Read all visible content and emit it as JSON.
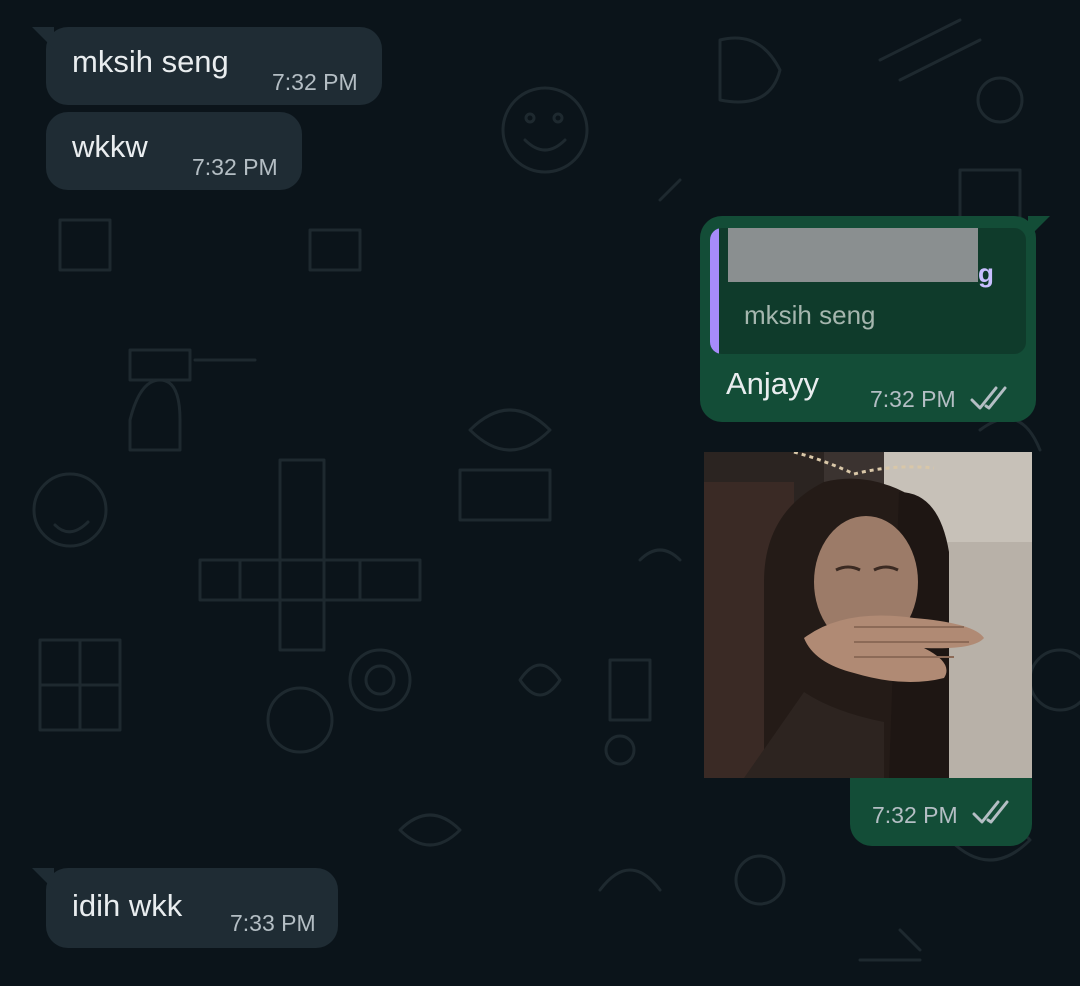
{
  "messages": [
    {
      "direction": "incoming",
      "text": "mksih seng",
      "time": "7:32 PM"
    },
    {
      "direction": "incoming",
      "text": "wkkw",
      "time": "7:32 PM"
    },
    {
      "direction": "outgoing",
      "quoted_text": "mksih seng",
      "text": "Anjayy",
      "time": "7:32 PM",
      "status": "read"
    },
    {
      "direction": "outgoing",
      "type": "image",
      "image_subject": "photo-of-person-covering-mouth",
      "time": "7:32 PM",
      "status": "read"
    },
    {
      "direction": "incoming",
      "text": "idih wkk",
      "time": "7:33 PM"
    }
  ],
  "quote_author_visible_fragment": "g",
  "colors": {
    "background": "#0b141a",
    "incoming_bubble": "#1f2c34",
    "outgoing_bubble": "#134d37",
    "quote_bar": "#a78bfa",
    "read_ticks": "#b4bec4"
  },
  "icons": [
    "double-check-icon"
  ]
}
